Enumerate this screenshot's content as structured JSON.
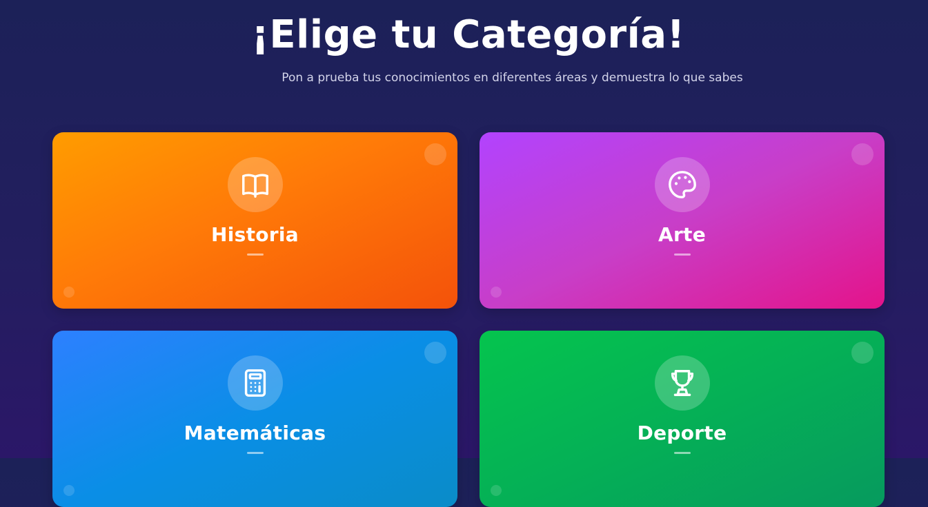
{
  "header": {
    "title": "¡Elige tu Categoría!",
    "subtitle": "Pon a prueba tus conocimientos en diferentes áreas y demuestra lo que sabes"
  },
  "categories": [
    {
      "label": "Historia",
      "icon": "book-icon",
      "gradient_from": "#ff9c00",
      "gradient_to": "#f4520a"
    },
    {
      "label": "Arte",
      "icon": "palette-icon",
      "gradient_from": "#b243fe",
      "gradient_to": "#e4138a"
    },
    {
      "label": "Matemáticas",
      "icon": "calculator-icon",
      "gradient_from": "#2d80ff",
      "gradient_to": "#0a8cc8"
    },
    {
      "label": "Deporte",
      "icon": "trophy-icon",
      "gradient_from": "#05c44e",
      "gradient_to": "#069a5e"
    }
  ],
  "colors": {
    "background_top": "#1c2158",
    "background_bottom": "#2b1768",
    "subtitle_text": "#d3d4ea"
  }
}
